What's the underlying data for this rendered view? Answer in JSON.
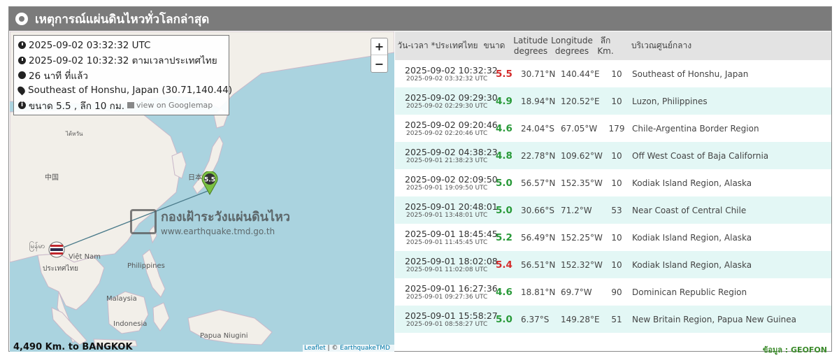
{
  "header": {
    "title": "เหตุการณ์แผ่นดินไหวทั่วโลกล่าสุด",
    "icon": "radio-icon"
  },
  "info_box": {
    "utc_time": "2025-09-02 03:32:32 UTC",
    "thai_time": "2025-09-02 10:32:32 ตามเวลาประเทศไทย",
    "ago": "26 นาที ที่แล้ว",
    "location": "Southeast of Honshu, Japan (30.71,140.44)",
    "mag_depth": "ขนาด 5.5 , ลึก 10 กม.",
    "map_link": "view on Googlemap"
  },
  "map": {
    "zoom_in": "+",
    "zoom_out": "−",
    "labels": {
      "china": "中国",
      "japan": "日本",
      "vietnam": "Việt Nam",
      "philippines": "Philippines",
      "malaysia": "Malaysia",
      "indonesia": "Indonesia",
      "papua": "Papua Niugini",
      "taiwan": "ไต้หวัน",
      "thailand": "ประเทศไทย",
      "myanmar": "မြန်မာ"
    },
    "marker_mag": "5.5",
    "watermark_title": "กองเฝ้าระวังแผ่นดินไหว",
    "watermark_url": "www.earthquake.tmd.go.th",
    "distance": "4,490 Km. to BANGKOK",
    "attribution_leaflet": "Leaflet",
    "attribution_sep": " | © ",
    "attribution_source": "EarthquakeTMD"
  },
  "table": {
    "headers": {
      "datetime": "วัน-เวลา *ประเทศไทย",
      "mag": "ขนาด",
      "lat_1": "Latitude",
      "lat_2": "degrees",
      "lon_1": "Longitude",
      "lon_2": "degrees",
      "depth_1": "ลึก",
      "depth_2": "Km.",
      "region": "บริเวณศูนย์กลาง"
    },
    "rows": [
      {
        "th": "2025-09-02 10:32:32",
        "utc": "2025-09-02 03:32:32 UTC",
        "mag": "5.5",
        "lat": "30.71°N",
        "lon": "140.44°E",
        "depth": "10",
        "region": "Southeast of Honshu, Japan"
      },
      {
        "th": "2025-09-02 09:29:30",
        "utc": "2025-09-02 02:29:30 UTC",
        "mag": "4.9",
        "lat": "18.94°N",
        "lon": "120.52°E",
        "depth": "10",
        "region": "Luzon, Philippines"
      },
      {
        "th": "2025-09-02 09:20:46",
        "utc": "2025-09-02 02:20:46 UTC",
        "mag": "4.6",
        "lat": "24.04°S",
        "lon": "67.05°W",
        "depth": "179",
        "region": "Chile-Argentina Border Region"
      },
      {
        "th": "2025-09-02 04:38:23",
        "utc": "2025-09-01 21:38:23 UTC",
        "mag": "4.8",
        "lat": "22.78°N",
        "lon": "109.62°W",
        "depth": "10",
        "region": "Off West Coast of Baja California"
      },
      {
        "th": "2025-09-02 02:09:50",
        "utc": "2025-09-01 19:09:50 UTC",
        "mag": "5.0",
        "lat": "56.57°N",
        "lon": "152.35°W",
        "depth": "10",
        "region": "Kodiak Island Region, Alaska"
      },
      {
        "th": "2025-09-01 20:48:01",
        "utc": "2025-09-01 13:48:01 UTC",
        "mag": "5.0",
        "lat": "30.66°S",
        "lon": "71.2°W",
        "depth": "53",
        "region": "Near Coast of Central Chile"
      },
      {
        "th": "2025-09-01 18:45:45",
        "utc": "2025-09-01 11:45:45 UTC",
        "mag": "5.2",
        "lat": "56.49°N",
        "lon": "152.25°W",
        "depth": "10",
        "region": "Kodiak Island Region, Alaska"
      },
      {
        "th": "2025-09-01 18:02:08",
        "utc": "2025-09-01 11:02:08 UTC",
        "mag": "5.4",
        "lat": "56.51°N",
        "lon": "152.32°W",
        "depth": "10",
        "region": "Kodiak Island Region, Alaska"
      },
      {
        "th": "2025-09-01 16:27:36",
        "utc": "2025-09-01 09:27:36 UTC",
        "mag": "4.6",
        "lat": "18.81°N",
        "lon": "69.7°W",
        "depth": "90",
        "region": "Dominican Republic Region"
      },
      {
        "th": "2025-09-01 15:58:27",
        "utc": "2025-09-01 08:58:27 UTC",
        "mag": "5.0",
        "lat": "6.37°S",
        "lon": "149.28°E",
        "depth": "51",
        "region": "New Britain Region, Papua New Guinea"
      }
    ],
    "source": "ข้อมูล : GEOFON"
  },
  "colors": {
    "header_bg": "#7b7b7b",
    "mag_high": "#d42c2c",
    "mag_low": "#2a9a3a",
    "row_alt": "#e3f7f5",
    "ocean": "#aad3df",
    "land": "#f2efe9"
  }
}
